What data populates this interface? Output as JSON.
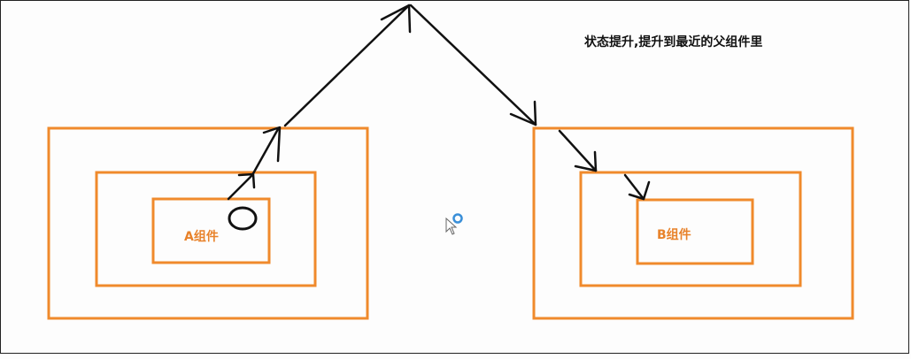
{
  "annotation": {
    "text": "状态提升,提升到最近的父组件里"
  },
  "left_group": {
    "label": "A组件"
  },
  "right_group": {
    "label": "B组件"
  },
  "colors": {
    "box": "#f08a2c",
    "label": "#e8822a",
    "arrow": "#111111",
    "cursor_ring": "#3a8fd8",
    "background": "#fdfdfd"
  },
  "icons": {
    "cursor": "mouse-cursor-icon"
  }
}
